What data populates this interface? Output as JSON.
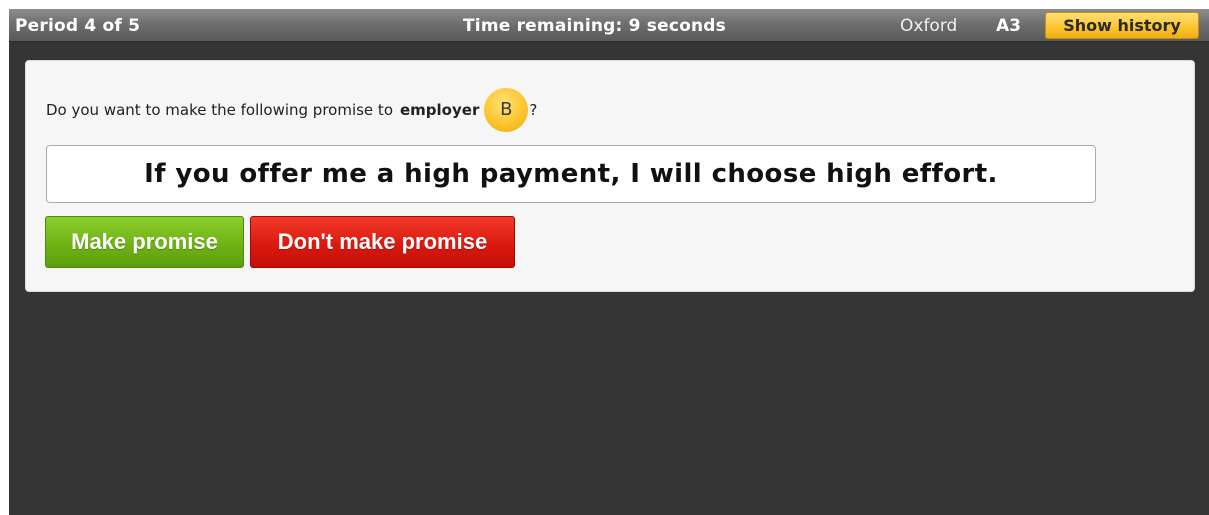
{
  "header": {
    "period": "Period 4 of 5",
    "timer": "Time remaining: 9 seconds",
    "location": "Oxford",
    "player_id": "A3",
    "history_button": "Show history"
  },
  "question": {
    "prefix": "Do you want to make the following promise to",
    "partner_role": "employer",
    "partner_badge": "B",
    "suffix": "?"
  },
  "promise_text": "If you offer me a high payment, I will choose high effort.",
  "actions": {
    "make": "Make promise",
    "dont": "Don't make promise"
  },
  "colors": {
    "background": "#353535",
    "topbar": "#6f6f6f",
    "accent_yellow": "#fbc52f",
    "make_green": "#6fb316",
    "dont_red": "#da1a10"
  }
}
